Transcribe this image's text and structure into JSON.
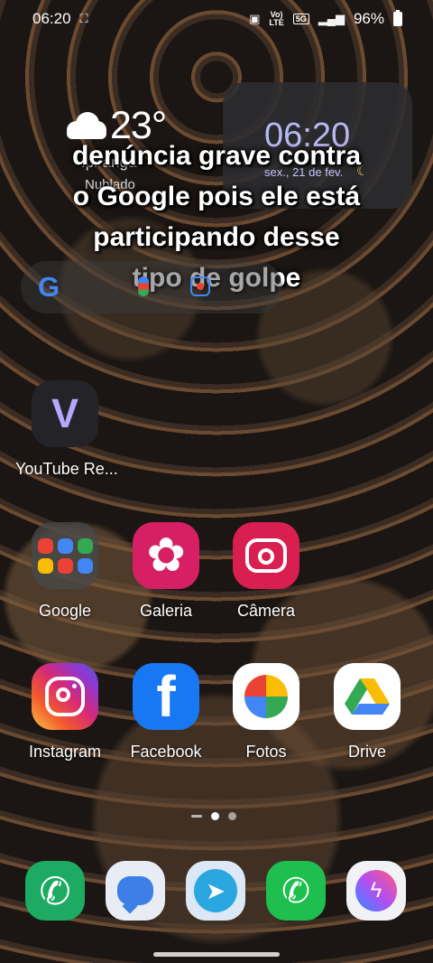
{
  "status_bar": {
    "time": "06:20",
    "network_label": "LTE",
    "network_prefix": "Vo)",
    "network_badge": "5G",
    "battery": "96%"
  },
  "weather": {
    "temperature": "23°",
    "location": "Ipiranga",
    "condition": "Nublado"
  },
  "clock_widget": {
    "time": "06:20",
    "date": "sex., 21 de fev."
  },
  "caption": {
    "line1": "denúncia grave contra",
    "line2": "o Google pois ele está",
    "line3": "participando desse",
    "line4": "tipo de golpe"
  },
  "search": {
    "logo": "G"
  },
  "apps": {
    "youtube_revanced": "YouTube Re...",
    "google_folder": "Google",
    "galeria": "Galeria",
    "camera": "Câmera",
    "instagram": "Instagram",
    "facebook": "Facebook",
    "fotos": "Fotos",
    "drive": "Drive"
  },
  "icons": {
    "youtube_glyph": "V",
    "facebook_glyph": "f",
    "telegram_glyph": "➤",
    "whatsapp_glyph": "✆",
    "messenger_glyph": "ϟ",
    "phone_glyph": "✆",
    "galeria_glyph": "✿"
  },
  "colors": {
    "clock_time": "#b8b8f4",
    "galeria": "#d61f64",
    "camera": "#d91f4f",
    "facebook": "#1877f2",
    "phone": "#1daa62",
    "whatsapp": "#1fbf4f"
  }
}
